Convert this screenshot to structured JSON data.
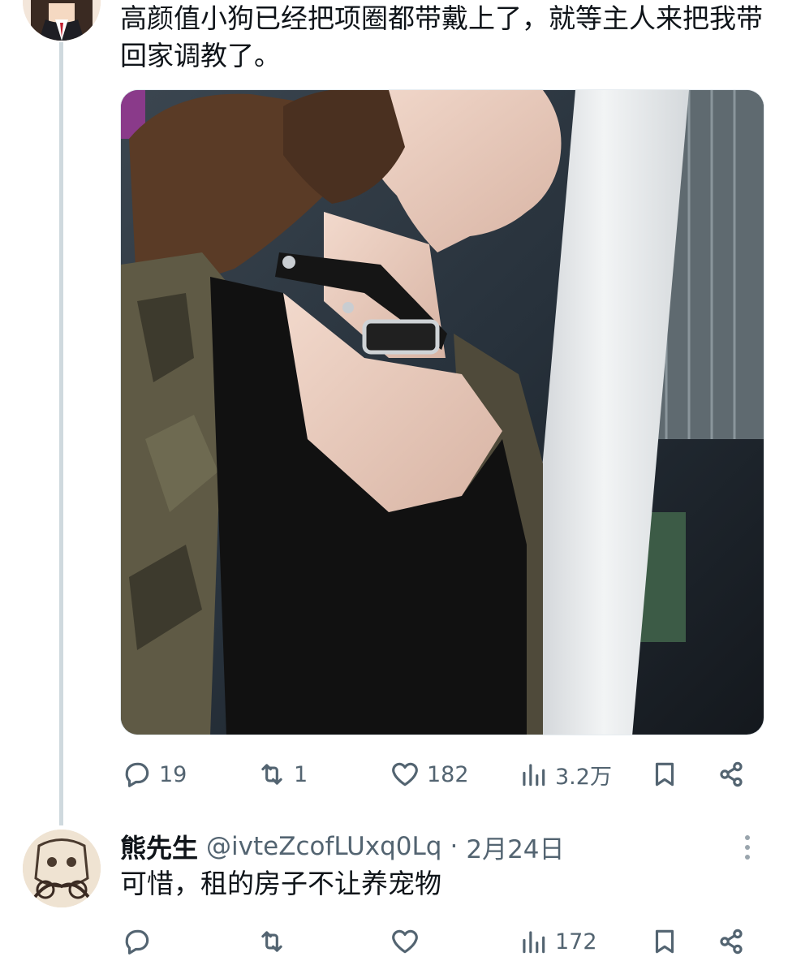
{
  "post": {
    "text": "高颜值小狗已经把项圈都带戴上了，就等主人来把我带回家调教了。",
    "actions": {
      "replies": "19",
      "reposts": "1",
      "likes": "182",
      "views": "3.2万"
    }
  },
  "reply": {
    "name": "熊先生",
    "handle": "@ivteZcofLUxq0Lq",
    "separator": "·",
    "date": "2月24日",
    "text": "可惜，租的房子不让养宠物",
    "actions": {
      "views": "172"
    }
  },
  "colors": {
    "text": "#0f1419",
    "secondary": "#536471",
    "thread_line": "#cfd9de"
  },
  "icons": {
    "reply": "reply-icon",
    "repost": "repost-icon",
    "like": "heart-icon",
    "views": "views-icon",
    "bookmark": "bookmark-icon",
    "share": "share-icon",
    "more": "more-icon"
  }
}
